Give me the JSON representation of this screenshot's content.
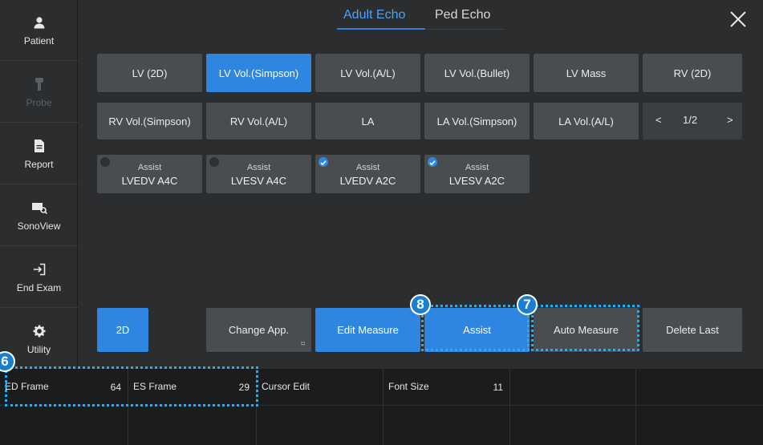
{
  "sidebar": {
    "items": [
      {
        "label": "Patient",
        "icon": "person-icon",
        "enabled": true
      },
      {
        "label": "Probe",
        "icon": "probe-icon",
        "enabled": false
      },
      {
        "label": "Report",
        "icon": "document-icon",
        "enabled": true
      },
      {
        "label": "SonoView",
        "icon": "sonoview-icon",
        "enabled": true
      },
      {
        "label": "End Exam",
        "icon": "exit-icon",
        "enabled": true
      },
      {
        "label": "Utility",
        "icon": "gear-icon",
        "enabled": true
      }
    ]
  },
  "tabs": {
    "active": "Adult Echo",
    "items": [
      "Adult Echo",
      "Ped Echo"
    ]
  },
  "measures": {
    "row1": [
      "LV (2D)",
      "LV Vol.(Simpson)",
      "LV Vol.(A/L)",
      "LV Vol.(Bullet)",
      "LV Mass",
      "RV (2D)"
    ],
    "row2": [
      "RV Vol.(Simpson)",
      "RV Vol.(A/L)",
      "LA",
      "LA Vol.(Simpson)",
      "LA Vol.(A/L)"
    ],
    "active": "LV Vol.(Simpson)",
    "pager": {
      "prev": "<",
      "page": "1/2",
      "next": ">"
    }
  },
  "assist_items": [
    {
      "top": "Assist",
      "bottom": "LVEDV A4C",
      "checked": false
    },
    {
      "top": "Assist",
      "bottom": "LVESV A4C",
      "checked": false
    },
    {
      "top": "Assist",
      "bottom": "LVEDV A2C",
      "checked": true
    },
    {
      "top": "Assist",
      "bottom": "LVESV A2C",
      "checked": true
    }
  ],
  "actions": {
    "mode": "2D",
    "change_app": "Change App.",
    "edit_measure": "Edit Measure",
    "assist": "Assist",
    "auto_measure": "Auto Measure",
    "delete_last": "Delete Last"
  },
  "bottom_bar": {
    "ed_frame": {
      "label": "ED Frame",
      "value": "64"
    },
    "es_frame": {
      "label": "ES Frame",
      "value": "29"
    },
    "cursor_edit": {
      "label": "Cursor Edit"
    },
    "font_size": {
      "label": "Font Size",
      "value": "11"
    }
  },
  "callouts": {
    "six": "6",
    "seven": "7",
    "eight": "8"
  },
  "colors": {
    "accent": "#2f86e0",
    "highlight": "#22aef0",
    "background": "#2b2d2f"
  }
}
